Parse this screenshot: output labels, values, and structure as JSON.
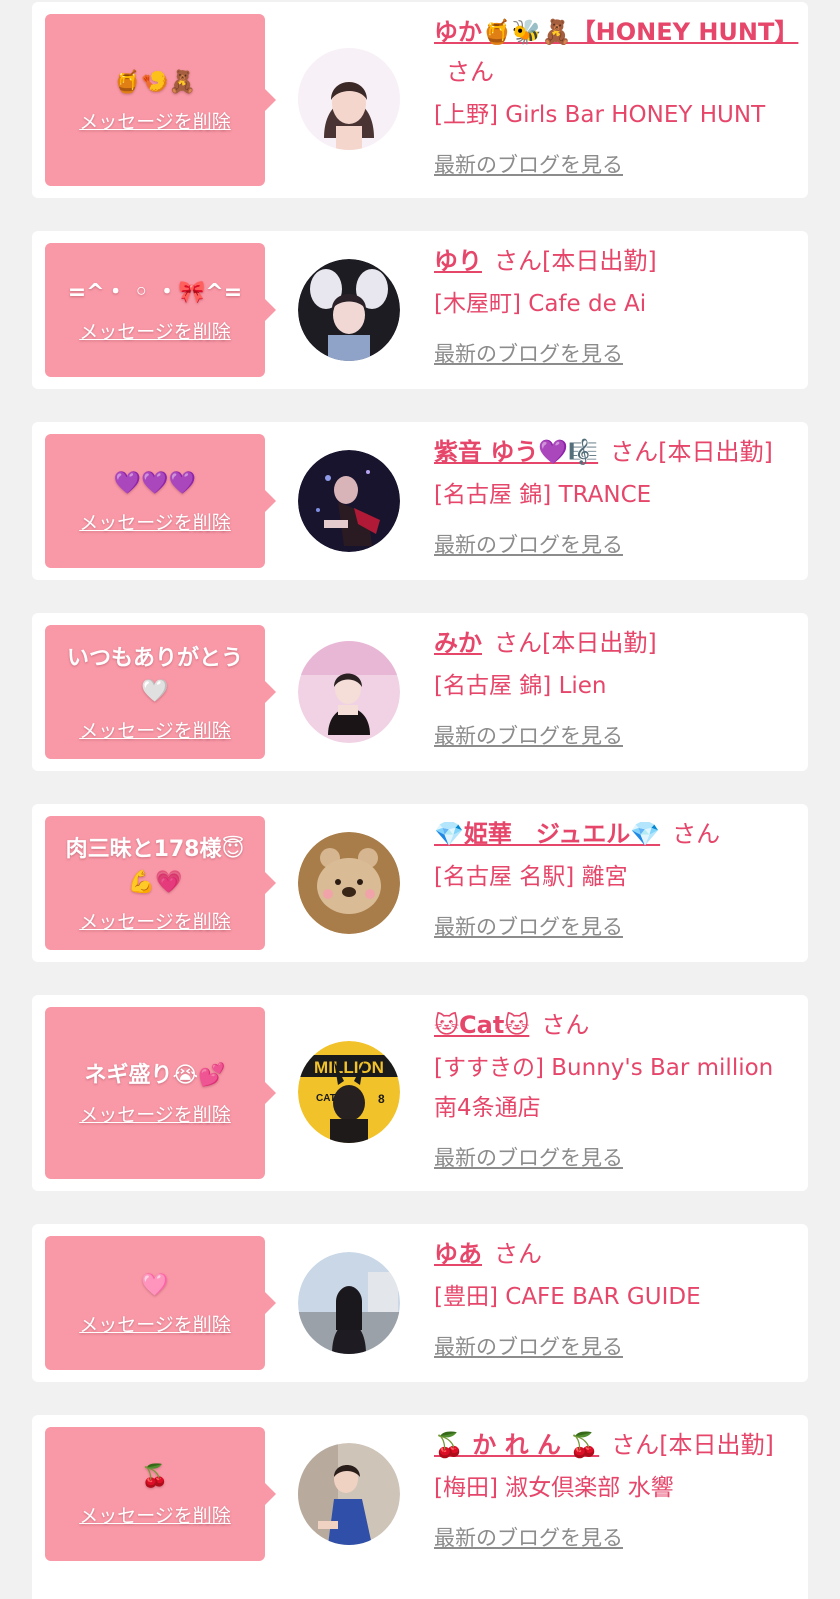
{
  "items": [
    {
      "message": "🍯🍤🧸",
      "delete_label": "メッセージを削除",
      "name": "ゆか🍯🐝🧸【HONEY HUNT】",
      "san": "さん",
      "status": "",
      "shop": "[上野] Girls Bar HONEY HUNT",
      "blog_label": "最新のブログを見る"
    },
    {
      "message": "=^・ ◦ ・🎀^=",
      "delete_label": "メッセージを削除",
      "name": "ゆり",
      "san": "さん",
      "status": "[本日出勤]",
      "shop": "[木屋町] Cafe de Ai",
      "blog_label": "最新のブログを見る"
    },
    {
      "message": "💜💜💜",
      "delete_label": "メッセージを削除",
      "name": "紫音 ゆう💜🎼",
      "san": "さん",
      "status": "[本日出勤]",
      "shop": "[名古屋 錦] TRANCE",
      "blog_label": "最新のブログを見る"
    },
    {
      "message": "いつもありがとう\n🤍",
      "delete_label": "メッセージを削除",
      "name": "みか",
      "san": "さん",
      "status": "[本日出勤]",
      "shop": "[名古屋 錦] Lien",
      "blog_label": "最新のブログを見る"
    },
    {
      "message": "肉三昧と178様😇\n💪💗",
      "delete_label": "メッセージを削除",
      "name": "💎姫華　ジュエル💎",
      "san": "さん",
      "status": "",
      "shop": "[名古屋 名駅] 離宮",
      "blog_label": "最新のブログを見る"
    },
    {
      "message": "ネギ盛り😭💕",
      "delete_label": "メッセージを削除",
      "name": "🐱Cat🐱",
      "san": "さん",
      "status": "",
      "shop": "[すすきの] Bunny's Bar million 南4条通店",
      "blog_label": "最新のブログを見る"
    },
    {
      "message": "🩷",
      "delete_label": "メッセージを削除",
      "name": "ゆあ",
      "san": "さん",
      "status": "",
      "shop": "[豊田] CAFE BAR GUIDE",
      "blog_label": "最新のブログを見る"
    },
    {
      "message": "🍒",
      "delete_label": "メッセージを削除",
      "name": "🍒 か れ ん 🍒",
      "san": "さん",
      "status": "[本日出勤]",
      "shop": "[梅田] 淑女倶楽部 水響",
      "blog_label": "最新のブログを見る"
    }
  ]
}
